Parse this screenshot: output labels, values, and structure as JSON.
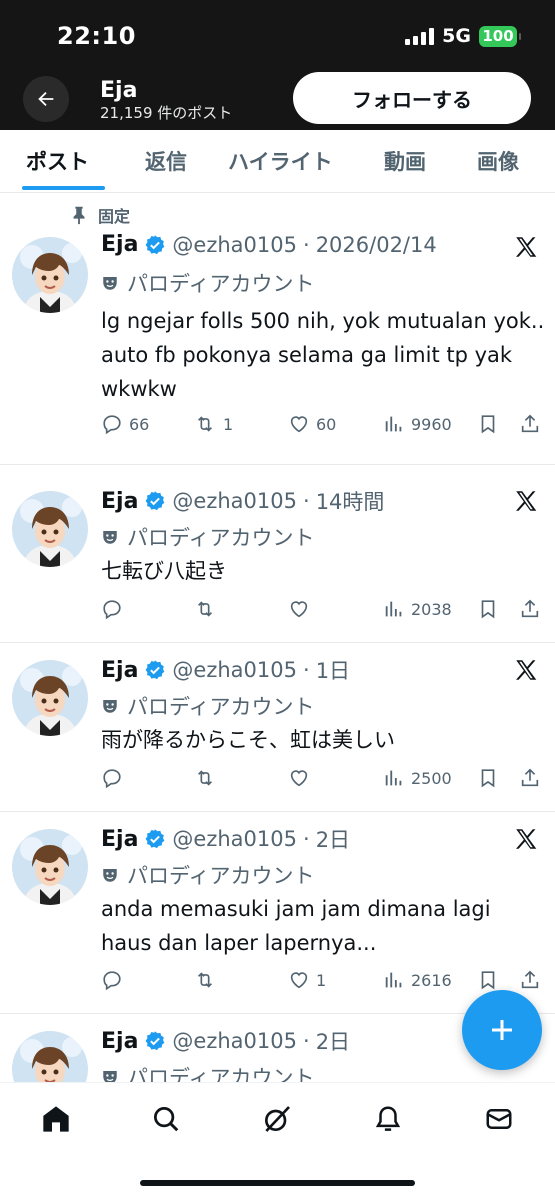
{
  "status_bar": {
    "time": "22:10",
    "network": "5G",
    "battery": "100"
  },
  "header": {
    "name": "Eja",
    "post_count": "21,159 件のポスト",
    "follow_label": "フォローする"
  },
  "tabs": [
    {
      "label": "ポスト",
      "active": true
    },
    {
      "label": "返信",
      "active": false
    },
    {
      "label": "ハイライト",
      "active": false
    },
    {
      "label": "動画",
      "active": false
    },
    {
      "label": "画像",
      "active": false
    }
  ],
  "pinned_label": "固定",
  "tweets": [
    {
      "name": "Eja",
      "handle": "@ezha0105",
      "time": "2026/02/14",
      "label": "パロディアカウント",
      "text": "lg ngejar folls 500 nih, yok mutualan yok.. auto fb pokonya selama ga limit tp yak wkwkw",
      "replies": "66",
      "reposts": "1",
      "likes": "60",
      "views": "9960"
    },
    {
      "name": "Eja",
      "handle": "@ezha0105",
      "time": "14時間",
      "label": "パロディアカウント",
      "text": "七転び八起き",
      "replies": "",
      "reposts": "",
      "likes": "",
      "views": "2038"
    },
    {
      "name": "Eja",
      "handle": "@ezha0105",
      "time": "1日",
      "label": "パロディアカウント",
      "text": "雨が降るからこそ、虹は美しい",
      "replies": "",
      "reposts": "",
      "likes": "",
      "views": "2500"
    },
    {
      "name": "Eja",
      "handle": "@ezha0105",
      "time": "2日",
      "label": "パロディアカウント",
      "text": "anda memasuki jam jam dimana lagi haus dan laper lapernya...",
      "replies": "",
      "reposts": "",
      "likes": "1",
      "views": "2616"
    },
    {
      "name": "Eja",
      "handle": "@ezha0105",
      "time": "2日",
      "label": "パロディアカウント"
    }
  ],
  "colors": {
    "accent": "#1d9bf0",
    "verified": "#1d9bf0",
    "header_bg": "#151515",
    "battery": "#34c759"
  },
  "icons": {
    "nav": [
      "home-icon",
      "search-icon",
      "grok-icon",
      "notifications-bell-icon",
      "messages-envelope-icon"
    ],
    "actions": [
      "reply-icon",
      "repost-icon",
      "like-heart-icon",
      "views-chart-icon",
      "bookmark-icon",
      "share-icon"
    ]
  }
}
